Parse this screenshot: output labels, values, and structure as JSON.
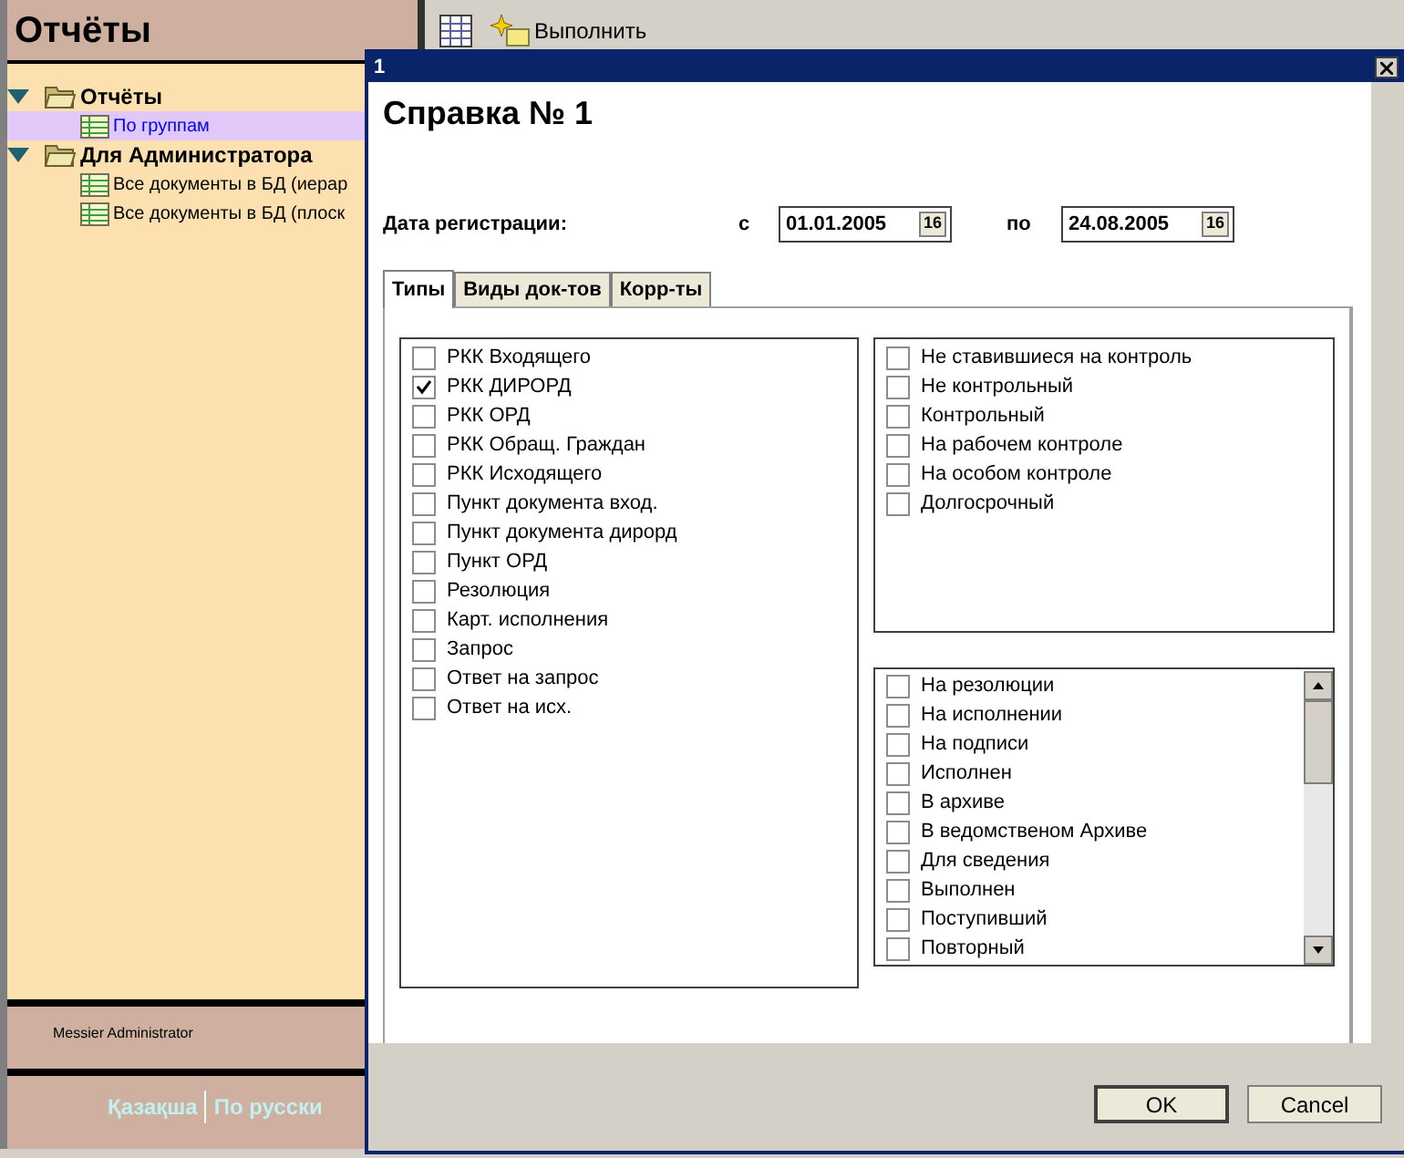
{
  "sidebar": {
    "title": "Отчёты",
    "tree": [
      {
        "label": "Отчёты",
        "expanded": true,
        "children": [
          {
            "label": "По группам",
            "selected": true
          }
        ]
      },
      {
        "label": "Для Администратора",
        "expanded": true,
        "children": [
          {
            "label": "Все документы в БД (иерар",
            "selected": false
          },
          {
            "label": "Все документы в БД (плоск",
            "selected": false
          }
        ]
      }
    ],
    "user": "Messier Administrator",
    "languages": [
      {
        "label": "Қазақша"
      },
      {
        "label": "По русски"
      }
    ]
  },
  "toolbar": {
    "run_label": "Выполнить"
  },
  "dialog": {
    "title": "1",
    "heading": "Справка № 1",
    "date_label": "Дата регистрации:",
    "from_label": "с",
    "from_value": "01.01.2005",
    "to_label": "по",
    "to_value": "24.08.2005",
    "from_calendar": "16",
    "to_calendar": "16",
    "tabs": [
      {
        "label": "Типы",
        "selected": true
      },
      {
        "label": "Виды док-тов",
        "selected": false
      },
      {
        "label": "Корр-ты",
        "selected": false
      }
    ],
    "types": [
      {
        "label": "РКК Входящего",
        "checked": false
      },
      {
        "label": "РКК ДИРОРД",
        "checked": true
      },
      {
        "label": "РКК ОРД",
        "checked": false
      },
      {
        "label": "РКК Обращ. Граждан",
        "checked": false
      },
      {
        "label": "РКК Исходящего",
        "checked": false
      },
      {
        "label": "Пункт документа вход.",
        "checked": false
      },
      {
        "label": "Пункт документа дирорд",
        "checked": false
      },
      {
        "label": "Пункт ОРД",
        "checked": false
      },
      {
        "label": "Резолюция",
        "checked": false
      },
      {
        "label": "Карт. исполнения",
        "checked": false
      },
      {
        "label": "Запрос",
        "checked": false
      },
      {
        "label": "Ответ на запрос",
        "checked": false
      },
      {
        "label": "Ответ на исх.",
        "checked": false
      }
    ],
    "control": [
      {
        "label": "Не ставившиеся на контроль",
        "checked": false
      },
      {
        "label": "Не контрольный",
        "checked": false
      },
      {
        "label": "Контрольный",
        "checked": false
      },
      {
        "label": "На рабочем контроле",
        "checked": false
      },
      {
        "label": "На особом контроле",
        "checked": false
      },
      {
        "label": "Долгосрочный",
        "checked": false
      }
    ],
    "statuses": [
      {
        "label": "На резолюции",
        "checked": false
      },
      {
        "label": "На исполнении",
        "checked": false
      },
      {
        "label": "На подписи",
        "checked": false
      },
      {
        "label": "Исполнен",
        "checked": false
      },
      {
        "label": "В архиве",
        "checked": false
      },
      {
        "label": "В ведомственом Архиве",
        "checked": false
      },
      {
        "label": "Для сведения",
        "checked": false
      },
      {
        "label": "Выполнен",
        "checked": false
      },
      {
        "label": "Поступивший",
        "checked": false
      },
      {
        "label": "Повторный",
        "checked": false
      }
    ],
    "buttons": [
      "OK",
      "Cancel"
    ]
  }
}
